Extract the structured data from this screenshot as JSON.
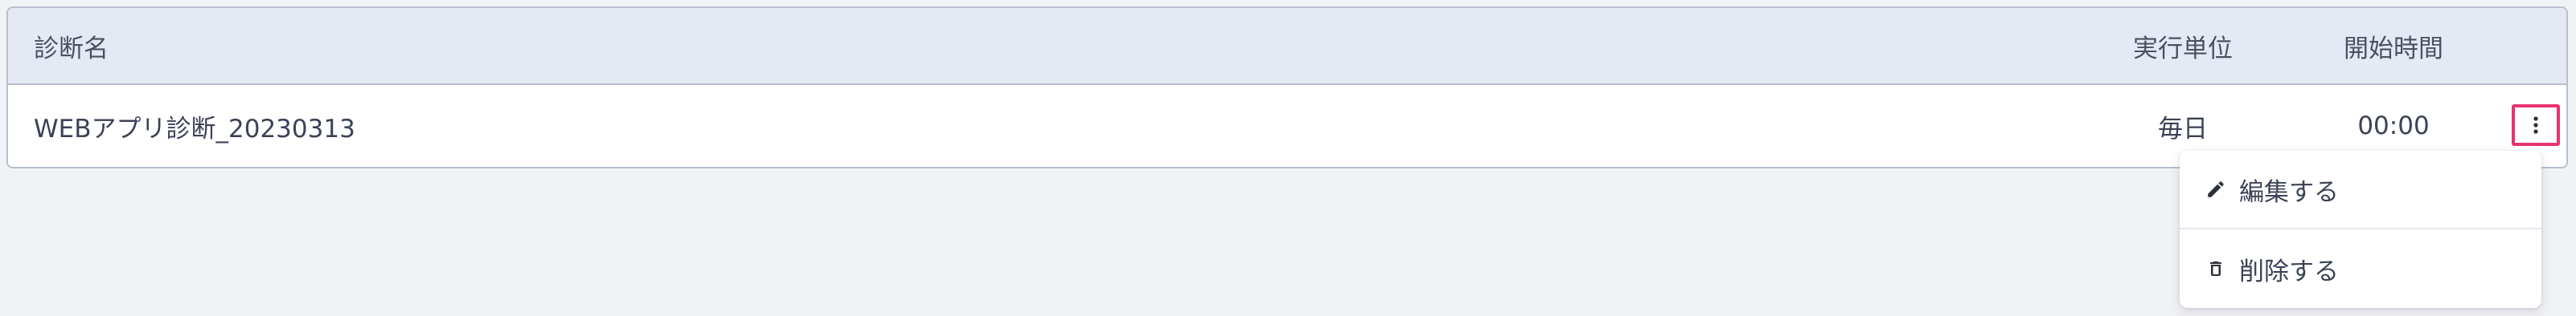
{
  "table": {
    "headers": {
      "name": "診断名",
      "unit": "実行単位",
      "start_time": "開始時間"
    },
    "rows": [
      {
        "name": "WEBアプリ診断_20230313",
        "unit": "毎日",
        "start_time": "00:00"
      }
    ]
  },
  "row_menu": {
    "items": [
      {
        "label": "編集する",
        "icon": "pencil-icon"
      },
      {
        "label": "削除する",
        "icon": "trash-icon"
      }
    ]
  },
  "colors": {
    "highlight_border": "#e8336e",
    "header_background": "#e5e9f3",
    "page_background": "#f1f2f5"
  }
}
